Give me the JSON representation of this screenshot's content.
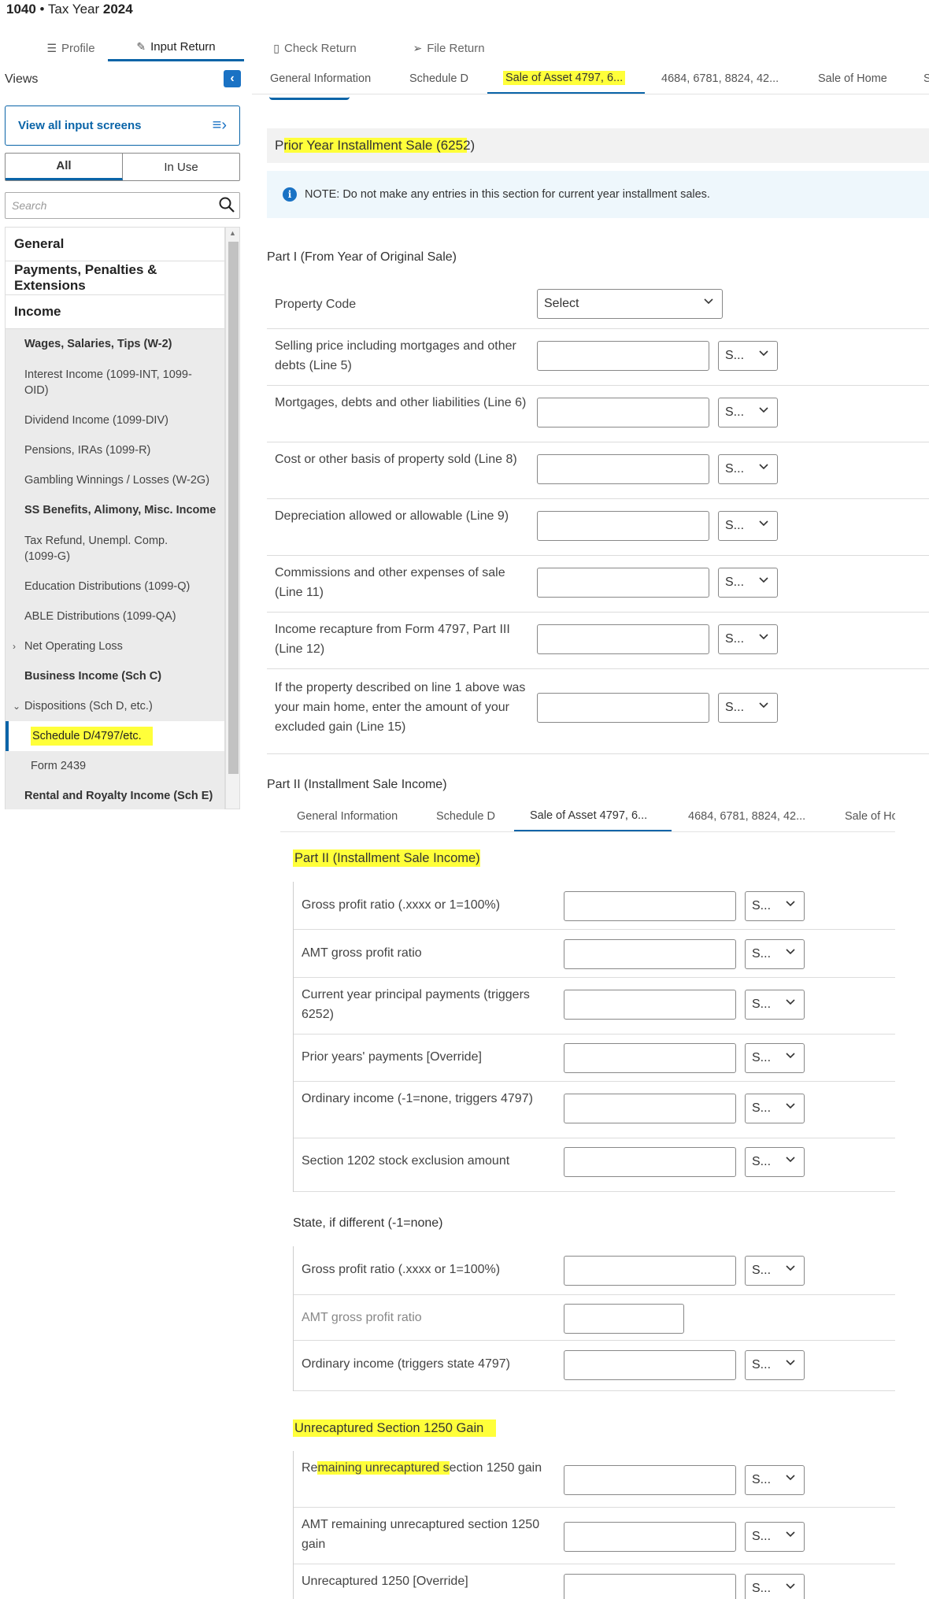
{
  "header": {
    "form": "1040",
    "separator": " • ",
    "year_label": "Tax Year",
    "year": "2024"
  },
  "main_tabs": [
    {
      "label": "Profile",
      "icon": "list-icon"
    },
    {
      "label": "Input Return",
      "icon": "pencil-icon"
    },
    {
      "label": "Check Return",
      "icon": "document-icon"
    },
    {
      "label": "File Return",
      "icon": "send-icon"
    }
  ],
  "sidebar": {
    "views_label": "Views",
    "collapse_glyph": "‹",
    "view_all_label": "View all input screens",
    "filter_all": "All",
    "filter_in_use": "In Use",
    "search_placeholder": "Search",
    "items": [
      "General",
      "Payments, Penalties & Extensions",
      "Income",
      "Wages, Salaries, Tips (W-2)",
      "Interest Income (1099-INT, 1099-OID)",
      "Dividend Income (1099-DIV)",
      "Pensions, IRAs (1099-R)",
      "Gambling Winnings / Losses (W-2G)",
      "SS Benefits, Alimony, Misc. Income",
      "Tax Refund, Unempl. Comp. (1099-G)",
      "Education Distributions (1099-Q)",
      "ABLE Distributions (1099-QA)",
      "Net Operating Loss",
      "Business Income (Sch C)",
      "Dispositions (Sch D, etc.)",
      "Schedule D/4797/etc.",
      "Form 2439",
      "Rental and Royalty Income (Sch E)"
    ]
  },
  "sub_tabs_top": [
    "General Information",
    "Schedule D",
    "Sale of Asset 4797, 6...",
    "4684, 6781, 8824, 42...",
    "Sale of Home",
    "S"
  ],
  "sub_tabs_bottom": [
    "General Information",
    "Schedule D",
    "Sale of Asset 4797, 6...",
    "4684, 6781, 8824, 42...",
    "Sale of Ho"
  ],
  "form": {
    "section_title": "Prior Year Installment Sale (6252)",
    "note_icon": "i",
    "note": "NOTE: Do not make any entries in this section for current year installment sales.",
    "part1_heading": "Part I (From Year of Original Sale)",
    "property_code_label": "Property Code",
    "property_code_value": "Select",
    "part1_rows": [
      "Selling price including mortgages and other debts (Line 5)",
      "Mortgages, debts and other liabilities (Line 6)",
      "Cost or other basis of property sold (Line 8)",
      "Depreciation allowed or allowable (Line 9)",
      "Commissions and other expenses of sale (Line 11)",
      "Income recapture from Form 4797, Part III (Line 12)",
      "If the property described on line 1 above was your main home, enter the amount of your excluded gain (Line 15)"
    ],
    "part2_heading": "Part II (Installment Sale Income)",
    "part2_rows": [
      "Gross profit ratio (.xxxx or 1=100%)",
      "AMT gross profit ratio",
      "Current year principal payments (triggers 6252)",
      "Prior years' payments [Override]",
      "Ordinary income (-1=none, triggers 4797)",
      "Section 1202 stock exclusion amount"
    ],
    "state_heading": "State, if different (-1=none)",
    "state_rows": [
      "Gross profit ratio (.xxxx or 1=100%)",
      "AMT gross profit ratio",
      "Ordinary income (triggers state 4797)"
    ],
    "unrecap_heading": "Unrecaptured Section 1250 Gain",
    "unrecap_rows": [
      "Remaining unrecaptured section 1250 gain",
      "AMT remaining unrecaptured section 1250 gain",
      "Unrecaptured 1250 [Override]"
    ],
    "state_select_value": "S..."
  },
  "colors": {
    "accent": "#0a64a8",
    "highlight": "#ffff3a",
    "note_bg": "#eef7fc"
  }
}
